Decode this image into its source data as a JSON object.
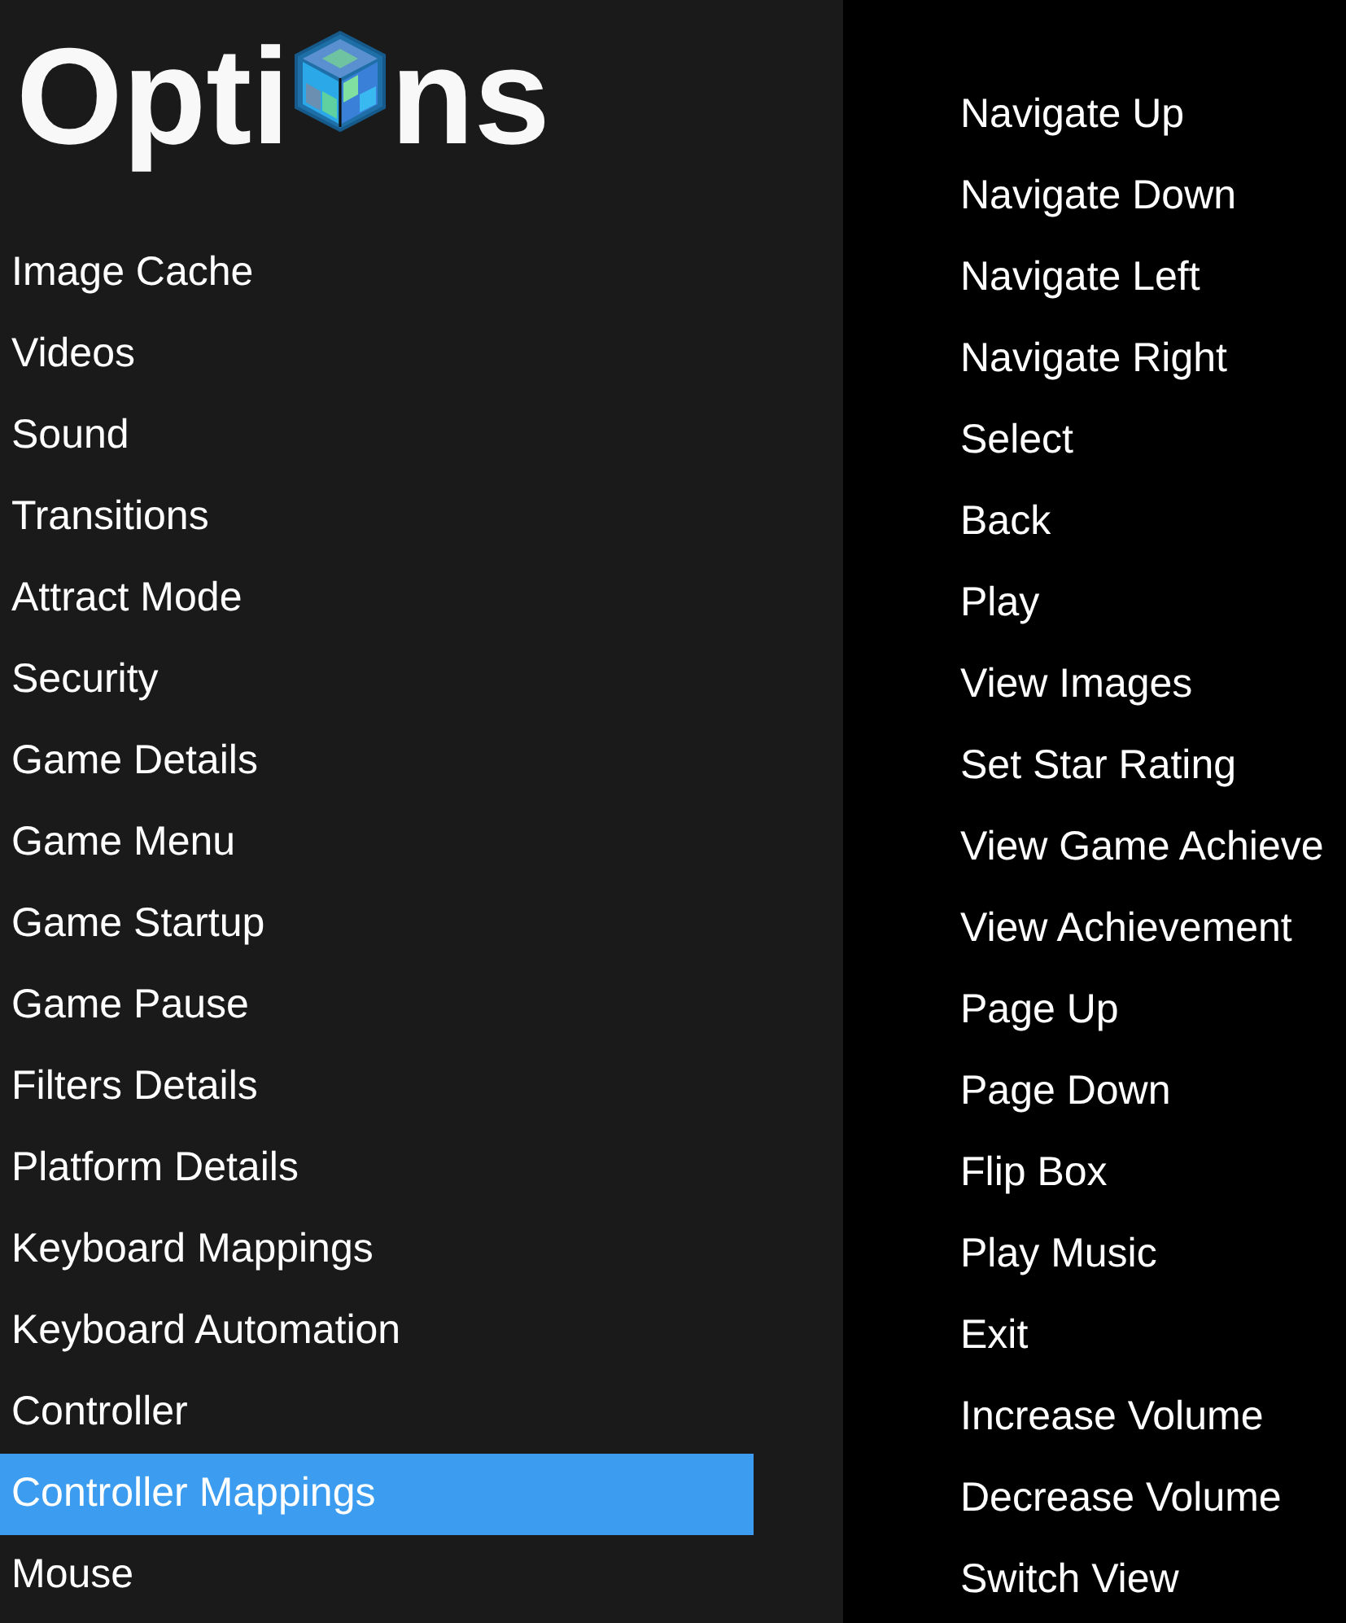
{
  "title": {
    "before_logo": "Opti",
    "after_logo": "ns"
  },
  "categories": [
    {
      "label": "Image Cache",
      "selected": false
    },
    {
      "label": "Videos",
      "selected": false
    },
    {
      "label": "Sound",
      "selected": false
    },
    {
      "label": "Transitions",
      "selected": false
    },
    {
      "label": "Attract Mode",
      "selected": false
    },
    {
      "label": "Security",
      "selected": false
    },
    {
      "label": "Game Details",
      "selected": false
    },
    {
      "label": "Game Menu",
      "selected": false
    },
    {
      "label": "Game Startup",
      "selected": false
    },
    {
      "label": "Game Pause",
      "selected": false
    },
    {
      "label": "Filters Details",
      "selected": false
    },
    {
      "label": "Platform Details",
      "selected": false
    },
    {
      "label": "Keyboard Mappings",
      "selected": false
    },
    {
      "label": "Keyboard Automation",
      "selected": false
    },
    {
      "label": "Controller",
      "selected": false
    },
    {
      "label": "Controller Mappings",
      "selected": true
    },
    {
      "label": "Mouse",
      "selected": false
    }
  ],
  "mappings": [
    "Navigate Up",
    "Navigate Down",
    "Navigate Left",
    "Navigate Right",
    "Select",
    "Back",
    "Play",
    "View Images",
    "Set Star Rating",
    "View Game Achieve",
    "View Achievement",
    "Page Up",
    "Page Down",
    "Flip Box",
    "Play Music",
    "Exit",
    "Increase Volume",
    "Decrease Volume",
    "Switch View"
  ]
}
